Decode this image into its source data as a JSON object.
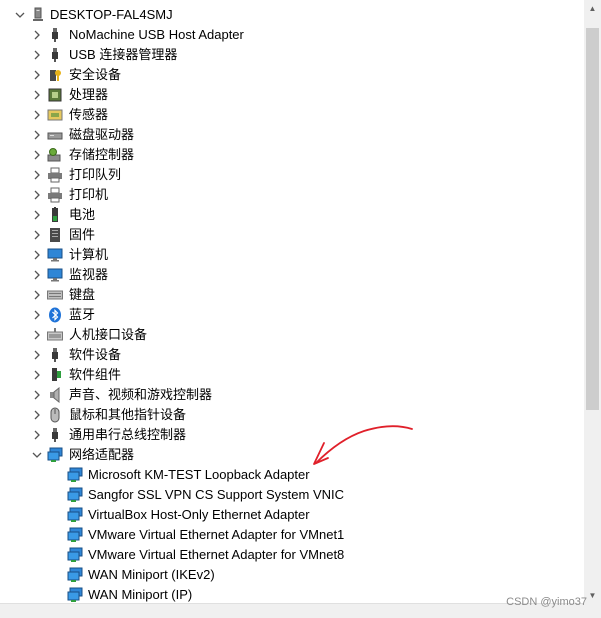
{
  "computer": {
    "name": "DESKTOP-FAL4SMJ",
    "icon": "computer-icon"
  },
  "categories": [
    {
      "label": "NoMachine USB Host Adapter",
      "icon": "usb-plug-icon",
      "expanded": false
    },
    {
      "label": "USB 连接器管理器",
      "icon": "usb-plug-icon",
      "expanded": false
    },
    {
      "label": "安全设备",
      "icon": "key-device-icon",
      "expanded": false
    },
    {
      "label": "处理器",
      "icon": "processor-icon",
      "expanded": false
    },
    {
      "label": "传感器",
      "icon": "sensor-icon",
      "expanded": false
    },
    {
      "label": "磁盘驱动器",
      "icon": "disk-drive-icon",
      "expanded": false
    },
    {
      "label": "存储控制器",
      "icon": "storage-controller-icon",
      "expanded": false
    },
    {
      "label": "打印队列",
      "icon": "printer-icon",
      "expanded": false
    },
    {
      "label": "打印机",
      "icon": "printer-icon",
      "expanded": false
    },
    {
      "label": "电池",
      "icon": "battery-icon",
      "expanded": false
    },
    {
      "label": "固件",
      "icon": "firmware-icon",
      "expanded": false
    },
    {
      "label": "计算机",
      "icon": "monitor-icon",
      "expanded": false
    },
    {
      "label": "监视器",
      "icon": "monitor-icon",
      "expanded": false
    },
    {
      "label": "键盘",
      "icon": "keyboard-icon",
      "expanded": false
    },
    {
      "label": "蓝牙",
      "icon": "bluetooth-icon",
      "expanded": false
    },
    {
      "label": "人机接口设备",
      "icon": "hid-icon",
      "expanded": false
    },
    {
      "label": "软件设备",
      "icon": "usb-plug-icon",
      "expanded": false
    },
    {
      "label": "软件组件",
      "icon": "software-component-icon",
      "expanded": false
    },
    {
      "label": "声音、视频和游戏控制器",
      "icon": "speaker-icon",
      "expanded": false
    },
    {
      "label": "鼠标和其他指针设备",
      "icon": "mouse-icon",
      "expanded": false
    },
    {
      "label": "通用串行总线控制器",
      "icon": "usb-plug-icon",
      "expanded": false
    },
    {
      "label": "网络适配器",
      "icon": "network-adapter-icon",
      "expanded": true
    }
  ],
  "network_adapters": [
    "Microsoft KM-TEST Loopback Adapter",
    "Sangfor SSL VPN CS Support System VNIC",
    "VirtualBox Host-Only Ethernet Adapter",
    "VMware Virtual Ethernet Adapter for VMnet1",
    "VMware Virtual Ethernet Adapter for VMnet8",
    "WAN Miniport (IKEv2)",
    "WAN Miniport (IP)"
  ],
  "watermark": "CSDN @yimo37",
  "colors": {
    "annotation": "#e0202a",
    "scroll_thumb": "#cdcdcd",
    "scroll_track": "#f0f0f0"
  },
  "scroll": {
    "thumb_start_fraction": 0.02,
    "thumb_end_fraction": 0.69
  }
}
